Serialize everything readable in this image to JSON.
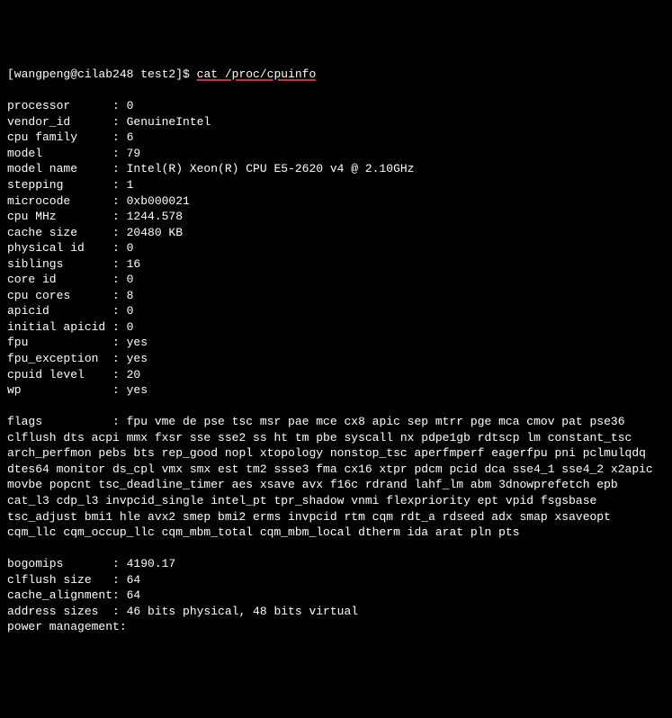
{
  "prompt": "[wangpeng@cilab248 test2]$ ",
  "command": "cat /proc/cpuinfo",
  "fields": [
    {
      "key": "processor",
      "value": "0"
    },
    {
      "key": "vendor_id",
      "value": "GenuineIntel"
    },
    {
      "key": "cpu family",
      "value": "6"
    },
    {
      "key": "model",
      "value": "79"
    },
    {
      "key": "model name",
      "value": "Intel(R) Xeon(R) CPU E5-2620 v4 @ 2.10GHz"
    },
    {
      "key": "stepping",
      "value": "1"
    },
    {
      "key": "microcode",
      "value": "0xb000021"
    },
    {
      "key": "cpu MHz",
      "value": "1244.578"
    },
    {
      "key": "cache size",
      "value": "20480 KB"
    },
    {
      "key": "physical id",
      "value": "0"
    },
    {
      "key": "siblings",
      "value": "16"
    },
    {
      "key": "core id",
      "value": "0"
    },
    {
      "key": "cpu cores",
      "value": "8"
    },
    {
      "key": "apicid",
      "value": "0"
    },
    {
      "key": "initial apicid",
      "value": "0"
    },
    {
      "key": "fpu",
      "value": "yes"
    },
    {
      "key": "fpu_exception",
      "value": "yes"
    },
    {
      "key": "cpuid level",
      "value": "20"
    },
    {
      "key": "wp",
      "value": "yes"
    }
  ],
  "flags_key": "flags",
  "flags_value": "fpu vme de pse tsc msr pae mce cx8 apic sep mtrr pge mca cmov pat pse36 clflush dts acpi mmx fxsr sse sse2 ss ht tm pbe syscall nx pdpe1gb rdtscp lm constant_tsc arch_perfmon pebs bts rep_good nopl xtopology nonstop_tsc aperfmperf eagerfpu pni pclmulqdq dtes64 monitor ds_cpl vmx smx est tm2 ssse3 fma cx16 xtpr pdcm pcid dca sse4_1 sse4_2 x2apic movbe popcnt tsc_deadline_timer aes xsave avx f16c rdrand lahf_lm abm 3dnowprefetch epb cat_l3 cdp_l3 invpcid_single intel_pt tpr_shadow vnmi flexpriority ept vpid fsgsbase tsc_adjust bmi1 hle avx2 smep bmi2 erms invpcid rtm cqm rdt_a rdseed adx smap xsaveopt cqm_llc cqm_occup_llc cqm_mbm_total cqm_mbm_local dtherm ida arat pln pts",
  "tail_fields": [
    {
      "key": "bogomips",
      "value": "4190.17"
    },
    {
      "key": "clflush size",
      "value": "64"
    },
    {
      "key": "cache_alignment",
      "value": "64"
    },
    {
      "key": "address sizes",
      "value": "46 bits physical, 48 bits virtual"
    },
    {
      "key": "power management",
      "value": ""
    }
  ]
}
